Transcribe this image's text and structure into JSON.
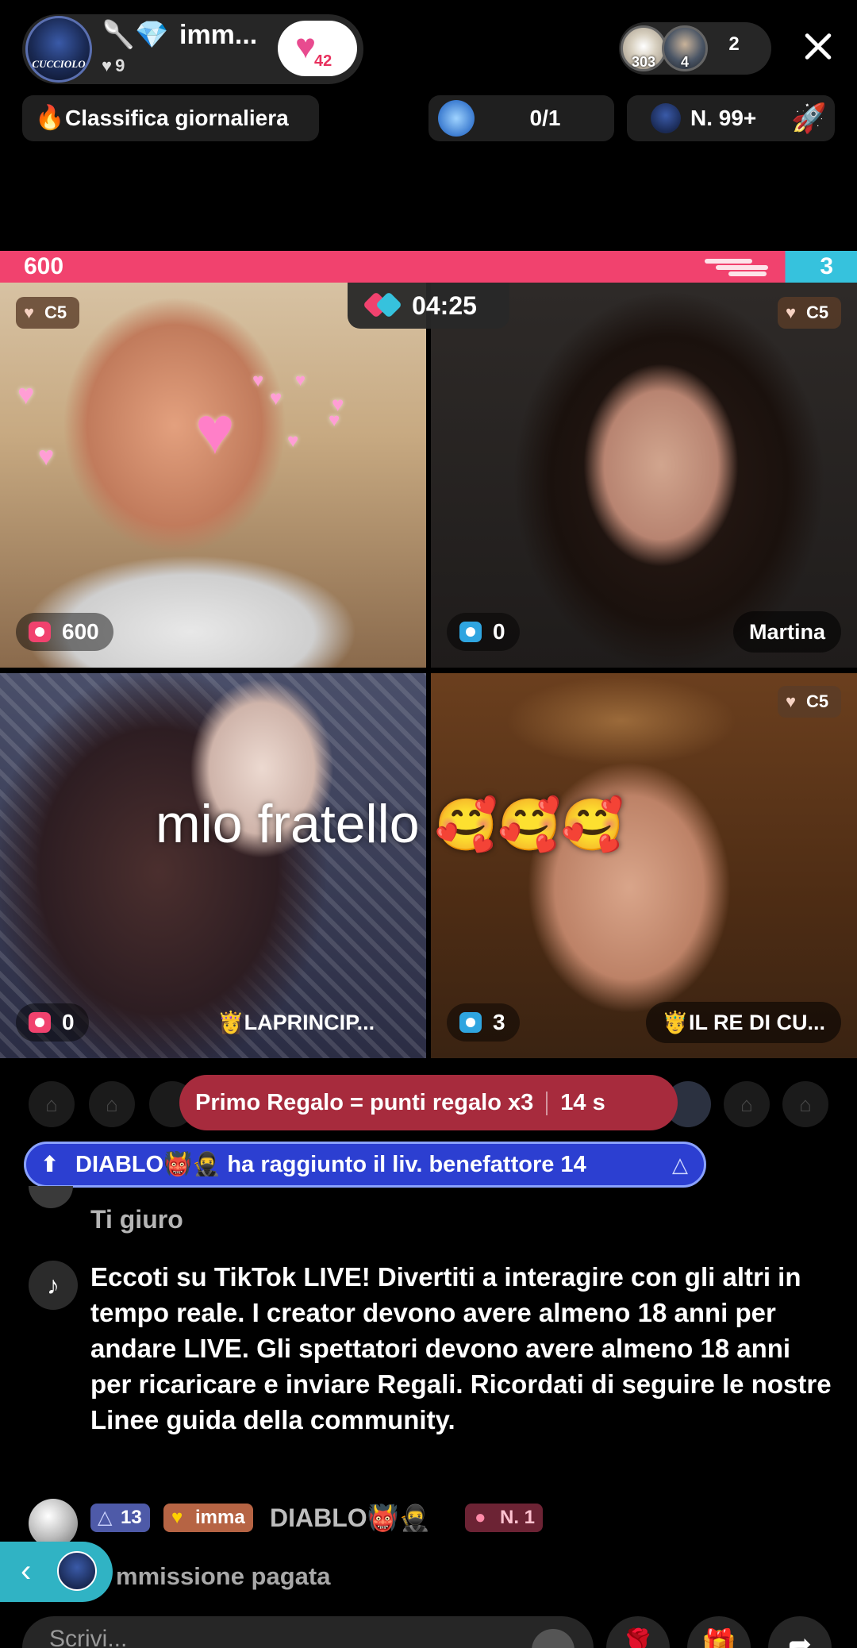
{
  "header": {
    "host_badges": "🥄💎",
    "host_name": "imm...",
    "host_avatar_label": "CUCCIOLO",
    "host_likes": "9",
    "follow_count": "42",
    "viewer_avatar_1_count": "303",
    "viewer_avatar_2_count": "4",
    "viewer_count": "2"
  },
  "ranking_pill": {
    "label": "Classifica giornaliera"
  },
  "goal_pill": {
    "value": "0/1"
  },
  "rank_pill": {
    "label": "N. 99+"
  },
  "battle": {
    "left_score": "600",
    "right_score": "3",
    "timer": "04:25",
    "left_share": 0.916
  },
  "tiles": [
    {
      "tier": "C5",
      "score": "600",
      "name": ""
    },
    {
      "tier": "C5",
      "score": "0",
      "name": "Martina"
    },
    {
      "tier": "",
      "score": "0",
      "name": "👸LAPRINCIP..."
    },
    {
      "tier": "C5",
      "score": "3",
      "name": "🤴IL RE DI CU..."
    }
  ],
  "overlay_text": "mio fratello",
  "overlay_emoji": "🥰🥰🥰",
  "gift_banner": {
    "text": "Primo Regalo = punti regalo x3",
    "countdown": "14 s"
  },
  "level_banner": {
    "text": "DIABLO👹🥷 ha raggiunto il liv. benefattore 14"
  },
  "comments": {
    "faded": "Ti giuro",
    "system_message": "Eccoti su TikTok LIVE! Divertiti a interagire con gli altri in tempo reale. I creator devono avere almeno 18 anni per andare LIVE. Gli spettatori devono avere almeno 18 anni per ricaricare e inviare Regali. Ricordati di seguire le nostre Linee guida della community.",
    "row": {
      "level_badge": "13",
      "fan_badge": "imma",
      "username": "DIABLO👹🥷",
      "rank_badge": "N. 1"
    },
    "paid_comment": "mmissione pagata"
  },
  "input": {
    "placeholder": "Scrivi..."
  },
  "colors": {
    "battle_pink": "#f1426e",
    "battle_blue": "#36c2dd",
    "level_banner": "#2c3fd1",
    "gift_banner": "#a72b3d"
  },
  "icons": [
    "heart-icon",
    "close-icon",
    "fire-icon",
    "goal-icon",
    "rocket-icon",
    "battle-icon",
    "camera-icon",
    "seat-icon",
    "arrow-up-icon",
    "chevron-left-icon",
    "gift-icon",
    "emoji-icon"
  ]
}
